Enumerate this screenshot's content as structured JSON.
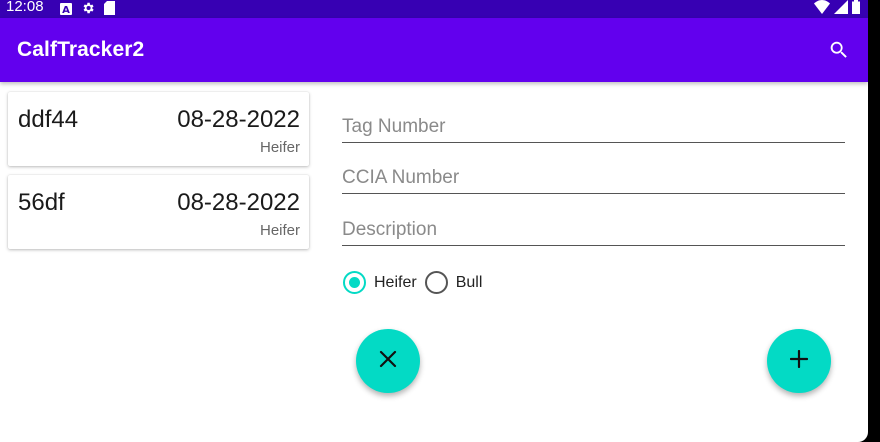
{
  "status_bar": {
    "time": "12:08",
    "icons": [
      "a-notification-icon",
      "gear-icon",
      "sd-card-icon",
      "wifi-icon",
      "signal-icon",
      "battery-icon"
    ]
  },
  "app_bar": {
    "title": "CalfTracker2",
    "search_icon": "search-icon"
  },
  "calf_list": [
    {
      "tag": "ddf44",
      "date": "08-28-2022",
      "sex": "Heifer"
    },
    {
      "tag": "56df",
      "date": "08-28-2022",
      "sex": "Heifer"
    }
  ],
  "form": {
    "tag_number": {
      "value": "",
      "placeholder": "Tag Number"
    },
    "ccia_number": {
      "value": "",
      "placeholder": "CCIA Number"
    },
    "description": {
      "value": "",
      "placeholder": "Description"
    },
    "sex_options": [
      {
        "label": "Heifer",
        "selected": true
      },
      {
        "label": "Bull",
        "selected": false
      }
    ]
  },
  "buttons": {
    "cancel_icon": "close-icon",
    "add_icon": "plus-icon"
  },
  "colors": {
    "status_bar": "#3700b3",
    "app_bar": "#6200ee",
    "accent": "#03dac5"
  }
}
